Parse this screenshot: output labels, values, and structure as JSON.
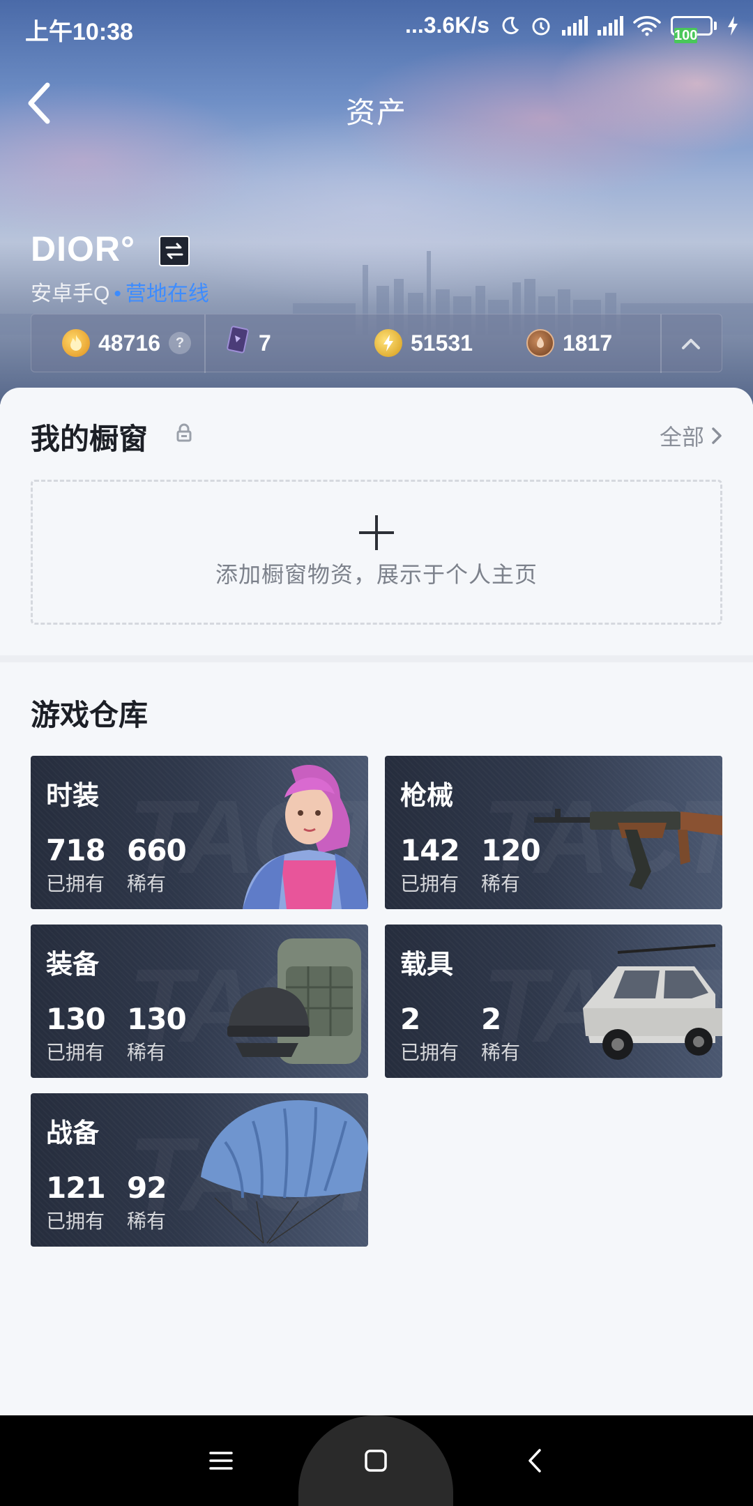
{
  "status_bar": {
    "time": "上午10:38",
    "net_speed": "...3.6K/s",
    "battery": "100"
  },
  "header": {
    "title": "资产",
    "back_icon": "chevron-left-icon"
  },
  "profile": {
    "name": "DIOR°",
    "platform": "安卓手Q",
    "status": "营地在线"
  },
  "currencies": [
    {
      "icon": "flame-coin-icon",
      "value": "48716",
      "help": "?"
    },
    {
      "icon": "purple-card-icon",
      "value": "7"
    },
    {
      "icon": "lightning-coin-icon",
      "value": "51531"
    },
    {
      "icon": "bronze-medal-icon",
      "value": "1817"
    }
  ],
  "showcase": {
    "title": "我的橱窗",
    "all_label": "全部",
    "add_text": "添加橱窗物资，展示于个人主页"
  },
  "warehouse": {
    "title": "游戏仓库",
    "cards": [
      {
        "name": "时装",
        "owned": "718",
        "owned_label": "已拥有",
        "rare": "660",
        "rare_label": "稀有",
        "art": "character-outfit-art"
      },
      {
        "name": "枪械",
        "owned": "142",
        "owned_label": "已拥有",
        "rare": "120",
        "rare_label": "稀有",
        "art": "rifle-art"
      },
      {
        "name": "装备",
        "owned": "130",
        "owned_label": "已拥有",
        "rare": "130",
        "rare_label": "稀有",
        "art": "backpack-helmet-art"
      },
      {
        "name": "载具",
        "owned": "2",
        "owned_label": "已拥有",
        "rare": "2",
        "rare_label": "稀有",
        "art": "car-art"
      },
      {
        "name": "战备",
        "owned": "121",
        "owned_label": "已拥有",
        "rare": "92",
        "rare_label": "稀有",
        "art": "parachute-art"
      }
    ]
  },
  "colors": {
    "accent_blue": "#3d8cff",
    "card_dark": "#262d3d",
    "sheet_bg": "#f5f7fa"
  }
}
